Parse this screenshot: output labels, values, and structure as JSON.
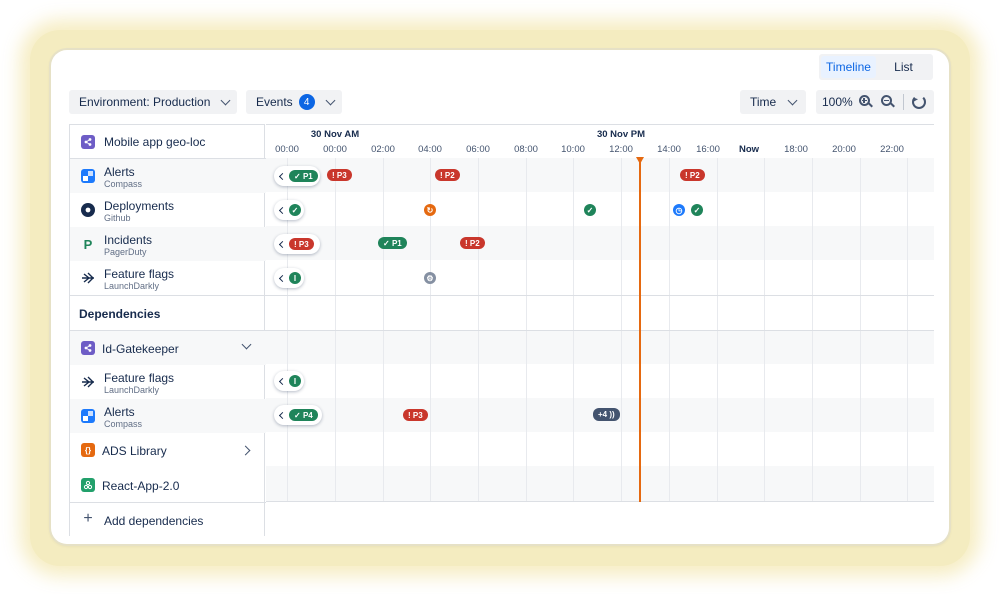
{
  "view_toggle": {
    "options": [
      "Timeline",
      "List"
    ],
    "active": "Timeline"
  },
  "toolbar": {
    "environment_label": "Environment: Production",
    "events_label": "Events",
    "events_count": "4",
    "time_label": "Time",
    "zoom_level": "100%"
  },
  "colors": {
    "accent": "#0c66e4",
    "now_line": "#e56910",
    "critical": "#c9372c",
    "success": "#1f845a"
  },
  "sidebar": {
    "service": {
      "name": "Mobile app geo-loc",
      "icon": "compass-icon"
    },
    "items": [
      {
        "name": "Alerts",
        "sub": "Compass",
        "icon": "compass-icon"
      },
      {
        "name": "Deployments",
        "sub": "Github",
        "icon": "github-icon"
      },
      {
        "name": "Incidents",
        "sub": "PagerDuty",
        "icon": "pagerduty-icon"
      },
      {
        "name": "Feature flags",
        "sub": "LaunchDarkly",
        "icon": "launchdarkly-icon"
      }
    ],
    "dependencies_label": "Dependencies",
    "dependency": {
      "name": "Id-Gatekeeper",
      "icon": "compass-icon"
    },
    "dep_items": [
      {
        "name": "Feature flags",
        "sub": "LaunchDarkly",
        "icon": "launchdarkly-icon"
      },
      {
        "name": "Alerts",
        "sub": "Compass",
        "icon": "compass-icon"
      }
    ],
    "ads_library": {
      "name": "ADS Library",
      "icon": "ads-library-icon"
    },
    "react_app": {
      "name": "React-App-2.0",
      "icon": "react-app-icon"
    },
    "add_dependencies": "Add dependencies"
  },
  "timeline": {
    "day_labels": [
      "30 Nov AM",
      "30 Nov PM"
    ],
    "ticks": [
      "00:00",
      "00:00",
      "02:00",
      "04:00",
      "06:00",
      "08:00",
      "10:00",
      "12:00",
      "14:00",
      "16:00",
      "Now",
      "18:00",
      "20:00",
      "22:00"
    ],
    "events": {
      "alerts": [
        "P1",
        "P3",
        "P2",
        "P2"
      ],
      "incidents": [
        "P3",
        "P1",
        "P2"
      ],
      "dep_alerts": [
        "P4",
        "P3"
      ],
      "overflow": "+4"
    }
  }
}
